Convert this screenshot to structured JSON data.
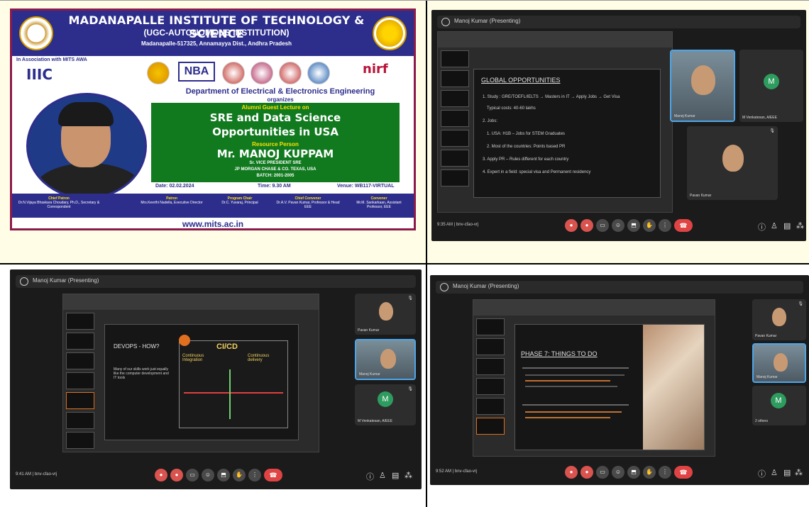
{
  "poster": {
    "institute": "MADANAPALLE INSTITUTE OF TECHNOLOGY & SCIENCE",
    "status": "(UGC-AUTONOMOUS INSTITUTION)",
    "address": "Madanapalle-517325, Annamayya Dist., Andhra Pradesh",
    "association": "In Association with MITS AWA",
    "iiic_logo": "IIIC",
    "nba_logo": "NBA",
    "nirf_logo": "nirf",
    "department": "Department of Electrical & Electronics Engineering",
    "organizes": "organizes",
    "event_type": "Alumni Guest Lecture on",
    "topic_line1": "SRE and Data Science",
    "topic_line2": "Opportunities in USA",
    "resource_label": "Resource Person",
    "speaker_name": "Mr. MANOJ KUPPAM",
    "speaker_line1": "Sr. VICE PRESIDENT SRE",
    "speaker_line2": "JP MORGAN CHASE & CO. TEXAS, USA",
    "speaker_line3": "BATCH: 2001-2005",
    "date": "Date: 02.02.2024",
    "time": "Time: 9.30 AM",
    "venue": "Venue: WB117-VIRTUAL",
    "footer_cols": [
      {
        "title": "Chief Patron",
        "body": "Dr.N.Vijaya Bhaskara Choudary, Ph.D., Secretary & Correspondent"
      },
      {
        "title": "Patron",
        "body": "Mrs.Keerthi Nadella, Executive Director"
      },
      {
        "title": "Program Chair",
        "body": "Dr.C. Yuvaraj, Principal"
      },
      {
        "title": "Chief Convener",
        "body": "Dr.A.V. Pavan Kumar, Professor & Head EEE"
      },
      {
        "title": "Convener",
        "body": "Mr.M. Sankarkaan, Assistant Professor, EEE"
      }
    ],
    "website": "www.mits.ac.in"
  },
  "meeting1": {
    "title": "Manoj Kumar (Presenting)",
    "slide_title": "GLOBAL OPPORTUNITIES",
    "slide_lines": [
      "1. Study : GRE/TOEFL/IELTS → Masters in IT → Apply Jobs → Get Visa",
      "Typical costs: 40-60 lakhs",
      "2. Jobs:",
      "1. USA: H1B – Jobs for STEM Graduates",
      "2. Most of the countries: Points based PR",
      "3. Apply PR – Rules different for each country",
      "4. Expert in a field: special visa and Permanent residency"
    ],
    "tiles": [
      {
        "name": "Manoj Kumar",
        "active": true
      },
      {
        "name": "M Venkatesan, A/EEE",
        "avatar": "M"
      },
      {
        "name": "Pavan Kumar"
      }
    ],
    "clock": "9:35 AM | bnv-cfao-vrj"
  },
  "meeting2": {
    "title": "Manoj Kumar (Presenting)",
    "slide_title": "DEVOPS - HOW?",
    "slide_text": "Many of our skills work just equally like the computer development and IT tools",
    "diagram_title": "CI/CD",
    "diagram_left": "Continuous Integration",
    "diagram_right": "Continuous delivery",
    "tiles": [
      {
        "name": "Pavan Kumar"
      },
      {
        "name": "Manoj Kumar",
        "active": true
      },
      {
        "name": "M Venkatesan, A/EEE",
        "avatar": "M"
      }
    ],
    "clock": "9:41 AM | bnv-cfao-vrj"
  },
  "meeting3": {
    "title": "Manoj Kumar (Presenting)",
    "slide_title": "PHASE 7: THINGS TO DO",
    "tiles": [
      {
        "name": "Pavan Kumar"
      },
      {
        "name": "Manoj Kumar",
        "active": true
      },
      {
        "name": "2 others",
        "avatar": "M"
      }
    ],
    "clock": "9:52 AM | bnv-cfao-vrj"
  },
  "colors": {
    "cream": "#fffde6",
    "poster_blue": "#2d2e8c",
    "poster_green": "#117a1f",
    "meet_bg": "#1b1b1b",
    "control_red": "#d9534f",
    "avatar_green": "#2e9c5e"
  },
  "icons": [
    "mic-icon",
    "camera-icon",
    "share-icon",
    "emoji-icon",
    "captions-icon",
    "raise-hand-icon",
    "more-icon",
    "end-call-icon",
    "info-icon",
    "people-icon",
    "chat-icon",
    "activities-icon"
  ]
}
